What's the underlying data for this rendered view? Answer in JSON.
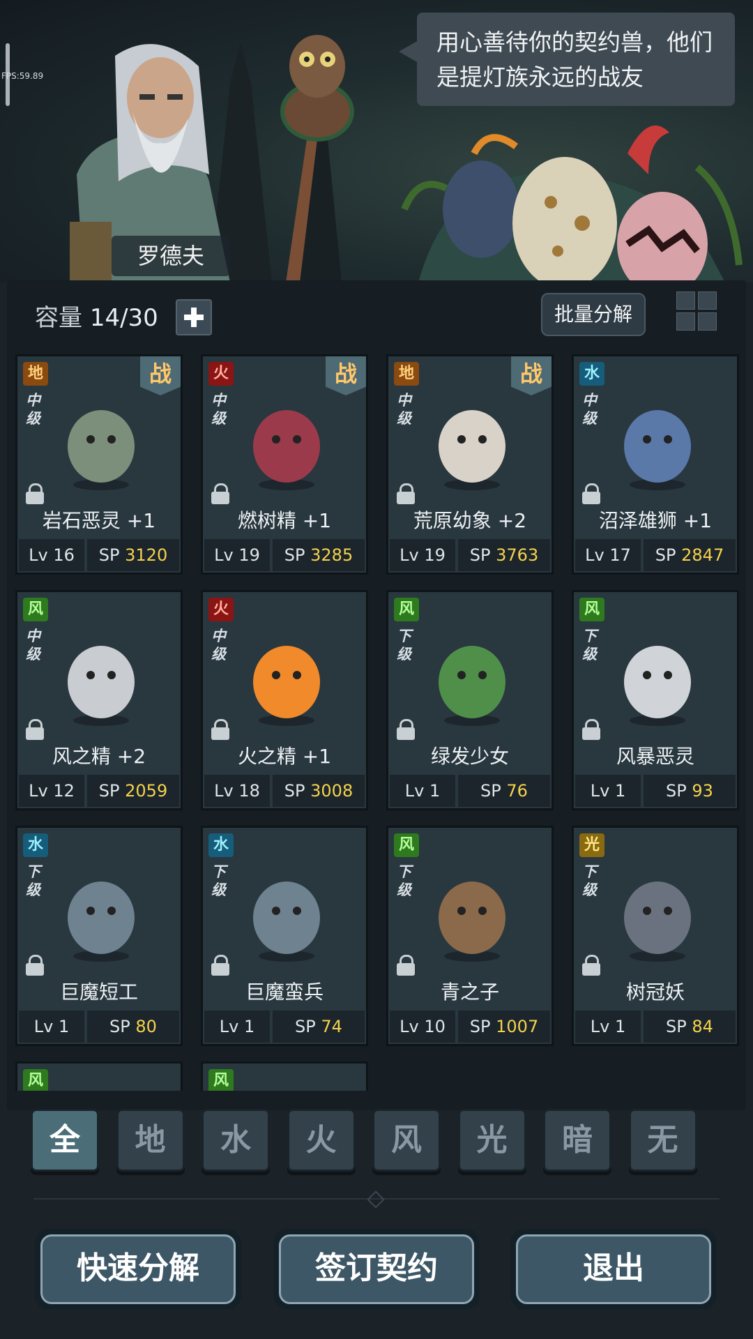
{
  "fps": "FPS:59.89",
  "dialog": {
    "speaker": "罗德夫",
    "text": "用心善待你的契约兽，他们是提灯族永远的战友"
  },
  "capacity": {
    "label": "容量",
    "value": "14/30"
  },
  "batch_button": "批量分解",
  "battle_badge": "战",
  "cards": [
    {
      "element": "地",
      "element_type": "earth",
      "grade": "中级",
      "name": "岩石恶灵 +1",
      "level": "Lv 16",
      "sp_label": "SP",
      "sp": "3120",
      "in_battle": true,
      "locked": true
    },
    {
      "element": "火",
      "element_type": "fire",
      "grade": "中级",
      "name": "燃树精 +1",
      "level": "Lv 19",
      "sp_label": "SP",
      "sp": "3285",
      "in_battle": true,
      "locked": true
    },
    {
      "element": "地",
      "element_type": "earth",
      "grade": "中级",
      "name": "荒原幼象 +2",
      "level": "Lv 19",
      "sp_label": "SP",
      "sp": "3763",
      "in_battle": true,
      "locked": true
    },
    {
      "element": "水",
      "element_type": "water",
      "grade": "中级",
      "name": "沼泽雄狮 +1",
      "level": "Lv 17",
      "sp_label": "SP",
      "sp": "2847",
      "in_battle": false,
      "locked": true
    },
    {
      "element": "风",
      "element_type": "wind",
      "grade": "中级",
      "name": "风之精 +2",
      "level": "Lv 12",
      "sp_label": "SP",
      "sp": "2059",
      "in_battle": false,
      "locked": true
    },
    {
      "element": "火",
      "element_type": "fire",
      "grade": "中级",
      "name": "火之精 +1",
      "level": "Lv 18",
      "sp_label": "SP",
      "sp": "3008",
      "in_battle": false,
      "locked": true
    },
    {
      "element": "风",
      "element_type": "wind",
      "grade": "下级",
      "name": "绿发少女",
      "level": "Lv 1",
      "sp_label": "SP",
      "sp": "76",
      "in_battle": false,
      "locked": true
    },
    {
      "element": "风",
      "element_type": "wind",
      "grade": "下级",
      "name": "风暴恶灵",
      "level": "Lv 1",
      "sp_label": "SP",
      "sp": "93",
      "in_battle": false,
      "locked": true
    },
    {
      "element": "水",
      "element_type": "water",
      "grade": "下级",
      "name": "巨魔短工",
      "level": "Lv 1",
      "sp_label": "SP",
      "sp": "80",
      "in_battle": false,
      "locked": true
    },
    {
      "element": "水",
      "element_type": "water",
      "grade": "下级",
      "name": "巨魔蛮兵",
      "level": "Lv 1",
      "sp_label": "SP",
      "sp": "74",
      "in_battle": false,
      "locked": true
    },
    {
      "element": "风",
      "element_type": "wind",
      "grade": "下级",
      "name": "青之子",
      "level": "Lv 10",
      "sp_label": "SP",
      "sp": "1007",
      "in_battle": false,
      "locked": true
    },
    {
      "element": "光",
      "element_type": "light",
      "grade": "下级",
      "name": "树冠妖",
      "level": "Lv 1",
      "sp_label": "SP",
      "sp": "84",
      "in_battle": false,
      "locked": true
    }
  ],
  "partial_cards": [
    {
      "element": "风",
      "element_type": "wind"
    },
    {
      "element": "风",
      "element_type": "wind"
    }
  ],
  "filters": [
    "全",
    "地",
    "水",
    "火",
    "风",
    "光",
    "暗",
    "无"
  ],
  "active_filter": "全",
  "actions": {
    "quick": "快速分解",
    "sign": "签订契约",
    "exit": "退出"
  },
  "colors": {
    "sp_value": "#f4d24e",
    "battle_badge": "#ffc86a"
  }
}
